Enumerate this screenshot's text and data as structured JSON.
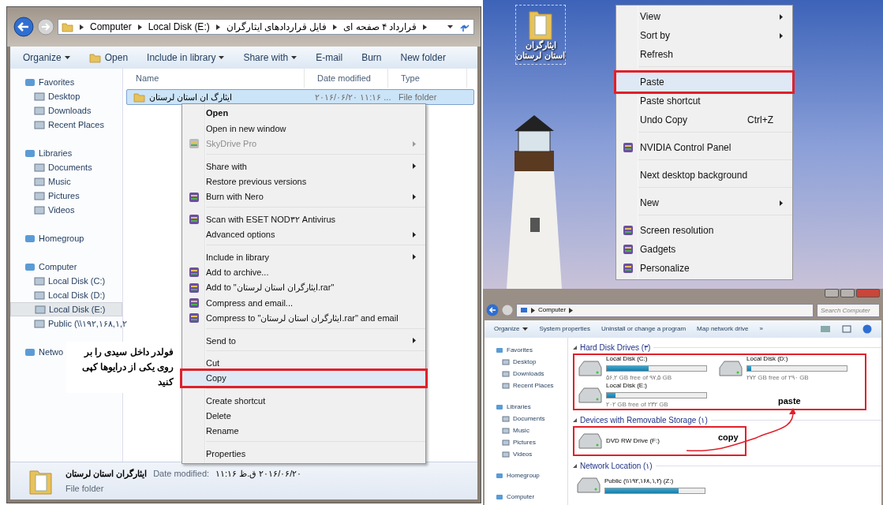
{
  "explorer": {
    "crumbs": [
      "Computer",
      "Local Disk (E:)",
      "فایل قراردادهای ایثارگران",
      "قرارداد ۴ صفحه ای"
    ],
    "toolbar": [
      {
        "label": "Organize",
        "dropdown": true,
        "icon": false
      },
      {
        "label": "Open",
        "dropdown": false,
        "icon": true
      },
      {
        "label": "Include in library",
        "dropdown": true,
        "icon": false
      },
      {
        "label": "Share with",
        "dropdown": true,
        "icon": false
      },
      {
        "label": "E-mail",
        "dropdown": false,
        "icon": false
      },
      {
        "label": "Burn",
        "dropdown": false,
        "icon": false
      },
      {
        "label": "New folder",
        "dropdown": false,
        "icon": false
      }
    ],
    "sidebar": [
      {
        "label": "Favorites",
        "kind": "group",
        "selected": false
      },
      {
        "label": "Desktop",
        "kind": "item",
        "selected": false
      },
      {
        "label": "Downloads",
        "kind": "item",
        "selected": false
      },
      {
        "label": "Recent Places",
        "kind": "item",
        "selected": false
      },
      {
        "label": "Libraries",
        "kind": "group",
        "selected": false
      },
      {
        "label": "Documents",
        "kind": "item",
        "selected": false
      },
      {
        "label": "Music",
        "kind": "item",
        "selected": false
      },
      {
        "label": "Pictures",
        "kind": "item",
        "selected": false
      },
      {
        "label": "Videos",
        "kind": "item",
        "selected": false
      },
      {
        "label": "Homegroup",
        "kind": "group",
        "selected": false
      },
      {
        "label": "Computer",
        "kind": "group",
        "selected": false
      },
      {
        "label": "Local Disk (C:)",
        "kind": "item",
        "selected": false
      },
      {
        "label": "Local Disk (D:)",
        "kind": "item",
        "selected": false
      },
      {
        "label": "Local Disk (E:)",
        "kind": "item",
        "selected": true
      },
      {
        "label": "Public (\\\\۱۹۲,۱۶۸,۱,۲",
        "kind": "item",
        "selected": false
      },
      {
        "label": "Netwo",
        "kind": "group",
        "selected": false
      }
    ],
    "columns": [
      "Name",
      "Date modified",
      "Type"
    ],
    "rows": [
      {
        "name": "ایثارگ ان استان لرستان",
        "date": "۲۰۱۶/۰۶/۲۰ ۱۱:۱۶ ...",
        "type": "File folder",
        "selected": true
      }
    ],
    "context_menu": [
      {
        "kind": "item",
        "label": "Open",
        "bold": true,
        "disabled": false,
        "submenu": false,
        "icon": false,
        "highlighted": false
      },
      {
        "kind": "item",
        "label": "Open in new window",
        "bold": false,
        "disabled": false,
        "submenu": false,
        "icon": false,
        "highlighted": false
      },
      {
        "kind": "item",
        "label": "SkyDrive Pro",
        "bold": false,
        "disabled": true,
        "submenu": true,
        "icon": true,
        "highlighted": false
      },
      {
        "kind": "separator"
      },
      {
        "kind": "item",
        "label": "Share with",
        "bold": false,
        "disabled": false,
        "submenu": true,
        "icon": false,
        "highlighted": false
      },
      {
        "kind": "item",
        "label": "Restore previous versions",
        "bold": false,
        "disabled": false,
        "submenu": false,
        "icon": false,
        "highlighted": false
      },
      {
        "kind": "item",
        "label": "Burn with Nero",
        "bold": false,
        "disabled": false,
        "submenu": true,
        "icon": true,
        "highlighted": false
      },
      {
        "kind": "separator"
      },
      {
        "kind": "item",
        "label": "Scan with ESET NOD۳۲ Antivirus",
        "bold": false,
        "disabled": false,
        "submenu": false,
        "icon": true,
        "highlighted": false
      },
      {
        "kind": "item",
        "label": "Advanced options",
        "bold": false,
        "disabled": false,
        "submenu": true,
        "icon": false,
        "highlighted": false
      },
      {
        "kind": "separator"
      },
      {
        "kind": "item",
        "label": "Include in library",
        "bold": false,
        "disabled": false,
        "submenu": true,
        "icon": false,
        "highlighted": false
      },
      {
        "kind": "item",
        "label": "Add to archive...",
        "bold": false,
        "disabled": false,
        "submenu": false,
        "icon": true,
        "highlighted": false
      },
      {
        "kind": "item",
        "label": "Add to \"ایثارگران استان لرستان.rar\"",
        "bold": false,
        "disabled": false,
        "submenu": false,
        "icon": true,
        "highlighted": false
      },
      {
        "kind": "item",
        "label": "Compress and email...",
        "bold": false,
        "disabled": false,
        "submenu": false,
        "icon": true,
        "highlighted": false
      },
      {
        "kind": "item",
        "label": "Compress to \"ایثارگران استان لرستان.rar\" and email",
        "bold": false,
        "disabled": false,
        "submenu": false,
        "icon": true,
        "highlighted": false
      },
      {
        "kind": "separator"
      },
      {
        "kind": "item",
        "label": "Send to",
        "bold": false,
        "disabled": false,
        "submenu": true,
        "icon": false,
        "highlighted": false
      },
      {
        "kind": "separator"
      },
      {
        "kind": "item",
        "label": "Cut",
        "bold": false,
        "disabled": false,
        "submenu": false,
        "icon": false,
        "highlighted": false
      },
      {
        "kind": "item",
        "label": "Copy",
        "bold": false,
        "disabled": false,
        "submenu": false,
        "icon": false,
        "highlighted": true
      },
      {
        "kind": "separator"
      },
      {
        "kind": "item",
        "label": "Create shortcut",
        "bold": false,
        "disabled": false,
        "submenu": false,
        "icon": false,
        "highlighted": false
      },
      {
        "kind": "item",
        "label": "Delete",
        "bold": false,
        "disabled": false,
        "submenu": false,
        "icon": false,
        "highlighted": false
      },
      {
        "kind": "item",
        "label": "Rename",
        "bold": false,
        "disabled": false,
        "submenu": false,
        "icon": false,
        "highlighted": false
      },
      {
        "kind": "separator"
      },
      {
        "kind": "item",
        "label": "Properties",
        "bold": false,
        "disabled": false,
        "submenu": false,
        "icon": false,
        "highlighted": false
      }
    ],
    "note": "فولدر داخل سیدی را بر روی یکی از درایوها کپی کنید",
    "details": {
      "name": "ایثارگران استان لرستان",
      "date_label": "Date modified:",
      "date": "۲۰۱۶/۰۶/۲۰ ق.ظ ۱۱:۱۶",
      "type": "File folder"
    }
  },
  "desktop": {
    "icon_label": "ایثارگران استان لرستان",
    "context_menu": [
      {
        "kind": "item",
        "label": "View",
        "submenu": true,
        "icon": false,
        "highlighted": false
      },
      {
        "kind": "item",
        "label": "Sort by",
        "submenu": true,
        "icon": false,
        "highlighted": false
      },
      {
        "kind": "item",
        "label": "Refresh",
        "submenu": false,
        "icon": false,
        "highlighted": false
      },
      {
        "kind": "separator"
      },
      {
        "kind": "item",
        "label": "Paste",
        "submenu": false,
        "icon": false,
        "highlighted": true
      },
      {
        "kind": "item",
        "label": "Paste shortcut",
        "submenu": false,
        "icon": false,
        "highlighted": false
      },
      {
        "kind": "item",
        "label": "Undo Copy",
        "shortcut": "Ctrl+Z",
        "submenu": false,
        "icon": false,
        "highlighted": false
      },
      {
        "kind": "separator"
      },
      {
        "kind": "item",
        "label": "NVIDIA Control Panel",
        "submenu": false,
        "icon": true,
        "highlighted": false
      },
      {
        "kind": "separator"
      },
      {
        "kind": "item",
        "label": "Next desktop background",
        "submenu": false,
        "icon": false,
        "highlighted": false
      },
      {
        "kind": "separator"
      },
      {
        "kind": "item",
        "label": "New",
        "submenu": true,
        "icon": false,
        "highlighted": false
      },
      {
        "kind": "separator"
      },
      {
        "kind": "item",
        "label": "Screen resolution",
        "submenu": false,
        "icon": true,
        "highlighted": false
      },
      {
        "kind": "item",
        "label": "Gadgets",
        "submenu": false,
        "icon": true,
        "highlighted": false
      },
      {
        "kind": "item",
        "label": "Personalize",
        "submenu": false,
        "icon": true,
        "highlighted": false
      }
    ]
  },
  "computer": {
    "crumbs": [
      "Computer"
    ],
    "search": {
      "placeholder": "Search Computer"
    },
    "toolbar": [
      {
        "label": "Organize",
        "dropdown": true
      },
      {
        "label": "System properties",
        "dropdown": false
      },
      {
        "label": "Uninstall or change a program",
        "dropdown": false
      },
      {
        "label": "Map network drive",
        "dropdown": false
      },
      {
        "label": "»",
        "dropdown": false
      }
    ],
    "sidebar": [
      {
        "label": "Favorites",
        "kind": "group"
      },
      {
        "label": "Desktop",
        "kind": "item"
      },
      {
        "label": "Downloads",
        "kind": "item"
      },
      {
        "label": "Recent Places",
        "kind": "item"
      },
      {
        "label": "Libraries",
        "kind": "group"
      },
      {
        "label": "Documents",
        "kind": "item"
      },
      {
        "label": "Music",
        "kind": "item"
      },
      {
        "label": "Pictures",
        "kind": "item"
      },
      {
        "label": "Videos",
        "kind": "item"
      },
      {
        "label": "Homegroup",
        "kind": "group"
      },
      {
        "label": "Computer",
        "kind": "group"
      }
    ],
    "sections": [
      {
        "title": "Hard Disk Drives (۳)",
        "boxed": true,
        "items": [
          {
            "name": "Local Disk (C:)",
            "free": "۵۶,۲ GB free of ۹۷,۵ GB",
            "level": 0.42
          },
          {
            "name": "Local Disk (D:)",
            "free": "۲۷۲ GB free of ۲۹۰ GB",
            "level": 0.04
          },
          {
            "name": "Local Disk (E:)",
            "free": "۲۰۲ GB free of ۲۳۲ GB",
            "level": 0.09
          }
        ]
      },
      {
        "title": "Devices with Removable Storage (۱)",
        "boxed": true,
        "items": [
          {
            "name": "DVD RW Drive (F:)"
          }
        ]
      },
      {
        "title": "Network Location (۱)",
        "boxed": false,
        "items": [
          {
            "name": "Public (\\\\۱۹۲,۱۶۸,۱,۲) (Z:)",
            "level": 0.74
          }
        ]
      }
    ],
    "annotations": {
      "paste": "paste",
      "copy": "copy"
    }
  }
}
